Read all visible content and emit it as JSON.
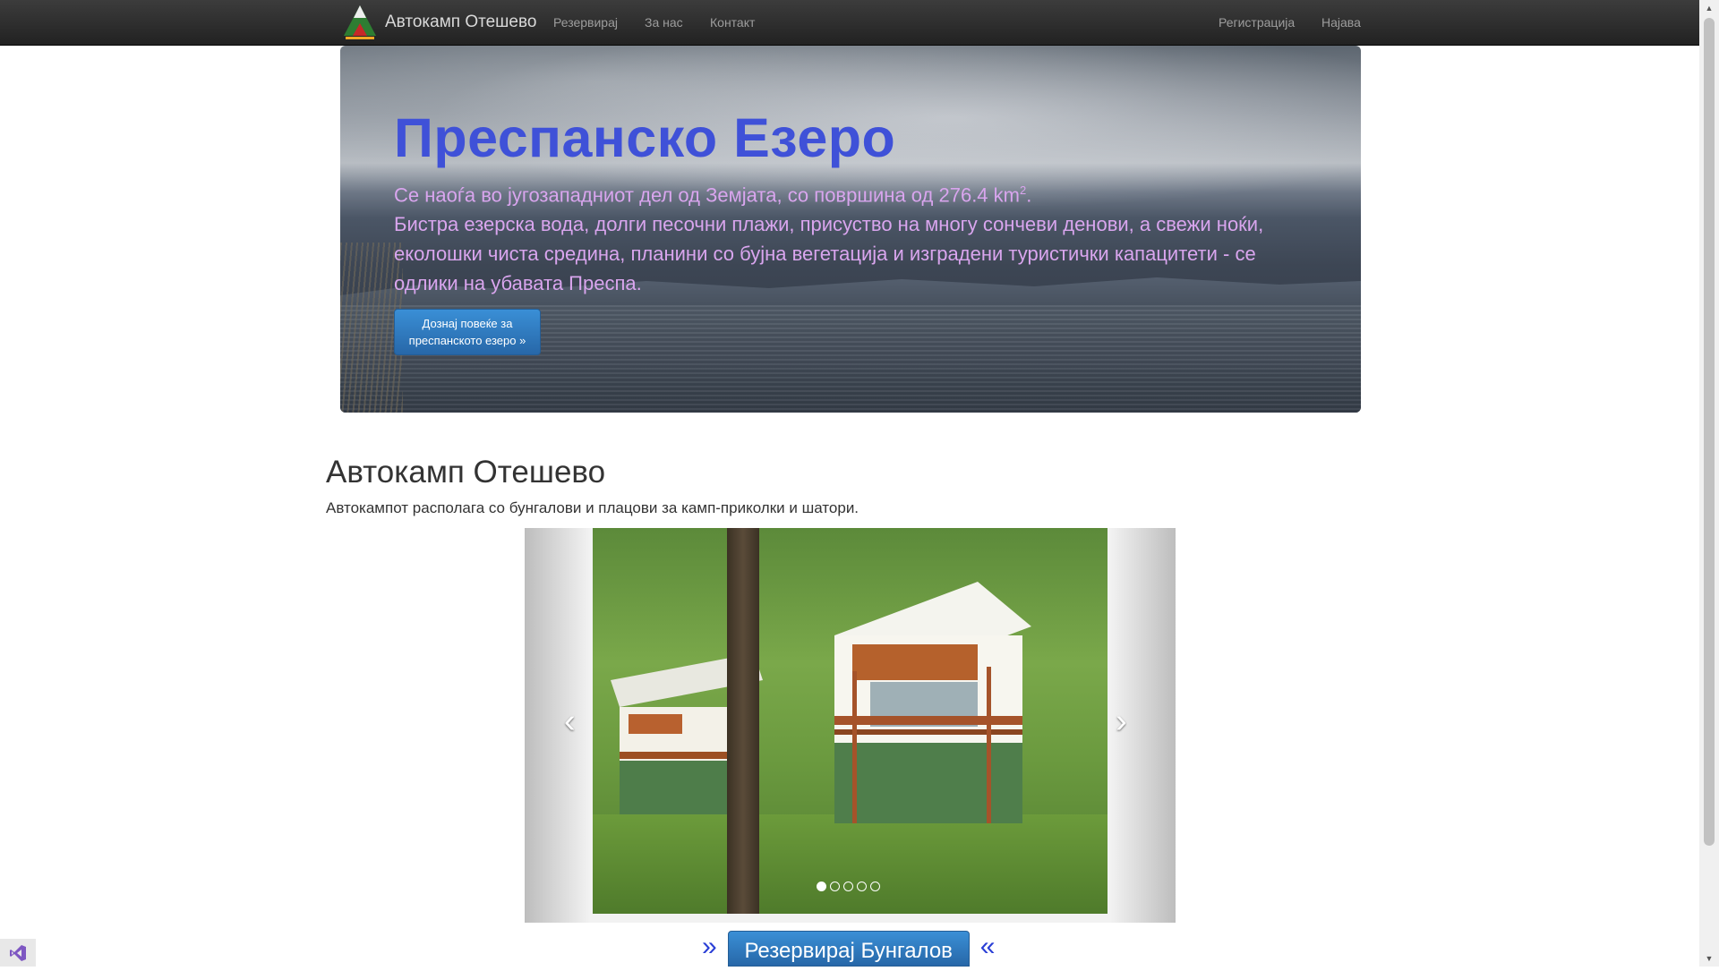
{
  "navbar": {
    "brand": "Автокамп Отешево",
    "links": [
      "Резервирај",
      "За нас",
      "Контакт"
    ],
    "right_links": [
      "Регистрација",
      "Најава"
    ]
  },
  "jumbotron": {
    "title": "Преспанско Езеро",
    "line1_prefix": "Се наоѓа во југозападниот дел од Земјата, со површина од 276.4 km",
    "line1_sup": "2",
    "line1_suffix": ".",
    "line2": "Бистра езерска вода, долги песочни плажи, присуство на многу сончеви денови, а свежи ноќи, еколошки чиста средина, планини со бујна вегетација и изградени туристички капацитети - се одлики на убавата Преспа.",
    "button": "Дознај повеќе за преспанското езеро »"
  },
  "section": {
    "title": "Автокамп Отешево",
    "description": "Автокампот располага со бунгалови и плацови за камп-приколки и шатори."
  },
  "carousel": {
    "prev": "‹",
    "next": "›",
    "indicator_count": 5,
    "active_index": 0
  },
  "reserve": {
    "left_mark": "»",
    "button": "Резервирај Бунгалов",
    "right_mark": "«"
  },
  "colors": {
    "title_blue": "#3f51d8",
    "text_pink": "#d9a5ee",
    "button_blue": "#2f7bc4"
  }
}
